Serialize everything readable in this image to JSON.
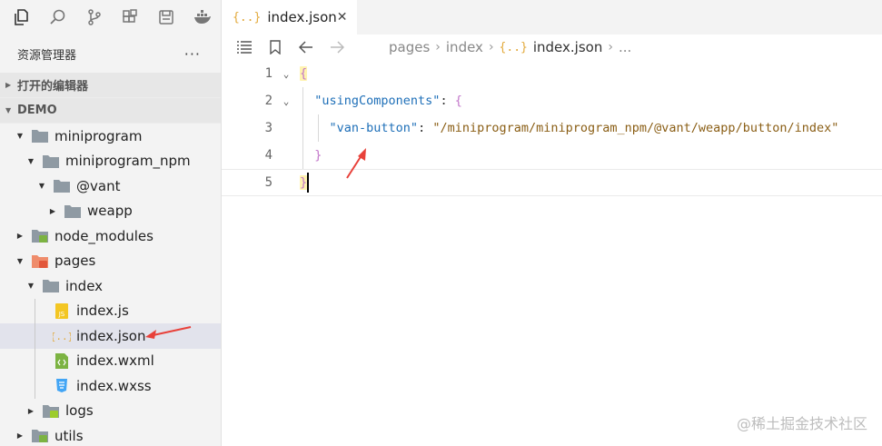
{
  "sidebar": {
    "header_title": "资源管理器",
    "more_label": "···",
    "open_editors_label": "打开的编辑器",
    "project_label": "DEMO"
  },
  "tree": [
    {
      "label": "miniprogram",
      "level": 0,
      "state": "expanded",
      "icon": "folder-icon"
    },
    {
      "label": "miniprogram_npm",
      "level": 1,
      "state": "expanded",
      "icon": "folder-icon"
    },
    {
      "label": "@vant",
      "level": 2,
      "state": "expanded",
      "icon": "folder-icon"
    },
    {
      "label": "weapp",
      "level": 3,
      "state": "collapsed",
      "icon": "folder-icon"
    },
    {
      "label": "node_modules",
      "level": 0,
      "state": "collapsed",
      "icon": "node-folder-icon"
    },
    {
      "label": "pages",
      "level": 0,
      "state": "expanded",
      "icon": "pages-folder-icon"
    },
    {
      "label": "index",
      "level": 1,
      "state": "expanded",
      "icon": "folder-icon"
    },
    {
      "label": "index.js",
      "level": 2,
      "state": "file",
      "icon": "js-file-icon"
    },
    {
      "label": "index.json",
      "level": 2,
      "state": "file",
      "icon": "json-file-icon",
      "selected": true
    },
    {
      "label": "index.wxml",
      "level": 2,
      "state": "file",
      "icon": "wxml-file-icon"
    },
    {
      "label": "index.wxss",
      "level": 2,
      "state": "file",
      "icon": "wxss-file-icon"
    },
    {
      "label": "logs",
      "level": 1,
      "state": "collapsed",
      "icon": "logs-folder-icon"
    },
    {
      "label": "utils",
      "level": 0,
      "state": "collapsed",
      "icon": "utils-folder-icon"
    }
  ],
  "editor": {
    "tab_label": "index.json",
    "tab_icon_text": "{..}",
    "breadcrumb": [
      "pages",
      "index",
      "index.json",
      "..."
    ],
    "lines": [
      {
        "n": "1",
        "parts": [
          {
            "t": "{",
            "c": "brace"
          }
        ]
      },
      {
        "n": "2",
        "parts": [
          {
            "t": "  ",
            "c": "punct"
          },
          {
            "t": "\"usingComponents\"",
            "c": "key"
          },
          {
            "t": ": ",
            "c": "punct"
          },
          {
            "t": "{",
            "c": "brace"
          }
        ]
      },
      {
        "n": "3",
        "parts": [
          {
            "t": "    ",
            "c": "punct"
          },
          {
            "t": "\"van-button\"",
            "c": "key"
          },
          {
            "t": ": ",
            "c": "punct"
          },
          {
            "t": "\"/miniprogram/miniprogram_npm/@vant/weapp/button/index\"",
            "c": "str"
          }
        ]
      },
      {
        "n": "4",
        "parts": [
          {
            "t": "  ",
            "c": "punct"
          },
          {
            "t": "}",
            "c": "brace"
          }
        ]
      },
      {
        "n": "5",
        "parts": [
          {
            "t": "}",
            "c": "brace"
          }
        ]
      }
    ]
  },
  "watermark": "@稀土掘金技术社区",
  "colors": {
    "selected_row": "#e2e3ec",
    "sidebar_bg": "#f3f3f3",
    "annotation_arrow": "#e8413a",
    "json_icon": "#e2a93b"
  }
}
